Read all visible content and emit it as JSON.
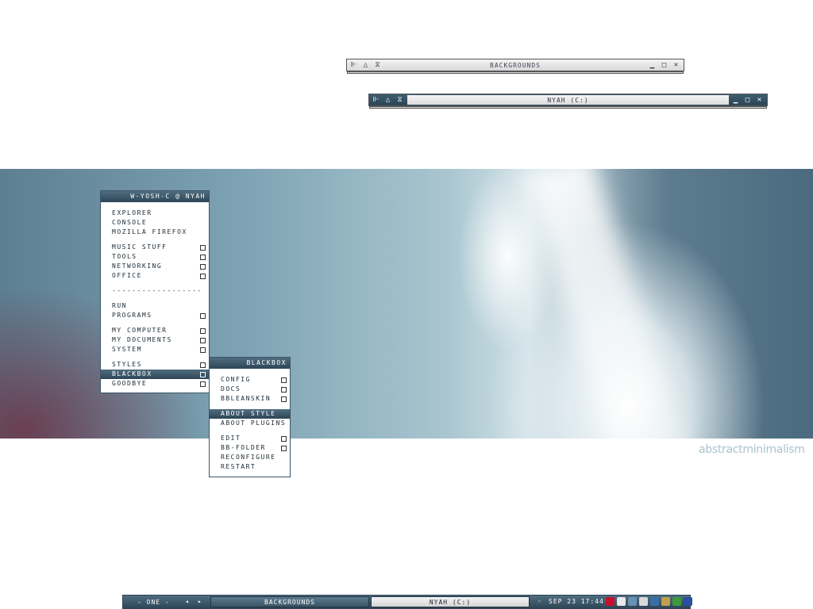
{
  "windows": [
    {
      "title": "BACKGROUNDS"
    },
    {
      "title": "NYAH (C:)"
    }
  ],
  "root_menu": {
    "title": "W-YOSH-C @ NYAH",
    "items": [
      {
        "label": "EXPLORER",
        "submenu": false
      },
      {
        "label": "CONSOLE",
        "submenu": false
      },
      {
        "label": "MOZILLA FIREFOX",
        "submenu": false
      },
      {
        "label": "MUSIC STUFF",
        "submenu": true
      },
      {
        "label": "TOOLS",
        "submenu": true
      },
      {
        "label": "NETWORKING",
        "submenu": true
      },
      {
        "label": "OFFICE",
        "submenu": true
      },
      {
        "label": "------------------",
        "submenu": false
      },
      {
        "label": "RUN",
        "submenu": false
      },
      {
        "label": "PROGRAMS",
        "submenu": true
      },
      {
        "label": "MY COMPUTER",
        "submenu": true
      },
      {
        "label": "MY DOCUMENTS",
        "submenu": true
      },
      {
        "label": "SYSTEM",
        "submenu": true
      },
      {
        "label": "STYLES",
        "submenu": true
      },
      {
        "label": "BLACKBOX",
        "submenu": true,
        "selected": true
      },
      {
        "label": "GOODBYE",
        "submenu": true
      }
    ]
  },
  "blackbox_menu": {
    "title": "BLACKBOX",
    "items": [
      {
        "label": "CONFIG",
        "submenu": true
      },
      {
        "label": "DOCS",
        "submenu": true
      },
      {
        "label": "BBLEANSKIN",
        "submenu": true
      },
      {
        "label": "ABOUT STYLE",
        "submenu": false,
        "selected": true
      },
      {
        "label": "ABOUT PLUGINS",
        "submenu": false
      },
      {
        "label": "EDIT",
        "submenu": true
      },
      {
        "label": "BB-FOLDER",
        "submenu": true
      },
      {
        "label": "RECONFIGURE",
        "submenu": false
      },
      {
        "label": "RESTART",
        "submenu": false
      }
    ]
  },
  "wallpaper": {
    "brand_text": "abstractminimalism"
  },
  "taskbar": {
    "workspace": "- ONE -",
    "tasks": [
      "BACKGROUNDS",
      "NYAH (C:)"
    ],
    "clock": "SEP 23 17:44",
    "tray_icons": [
      "ati-icon",
      "volume-icon",
      "network-icon",
      "speaker-icon",
      "display-icon",
      "sync-icon",
      "green-arrow-icon",
      "app-icon"
    ]
  }
}
